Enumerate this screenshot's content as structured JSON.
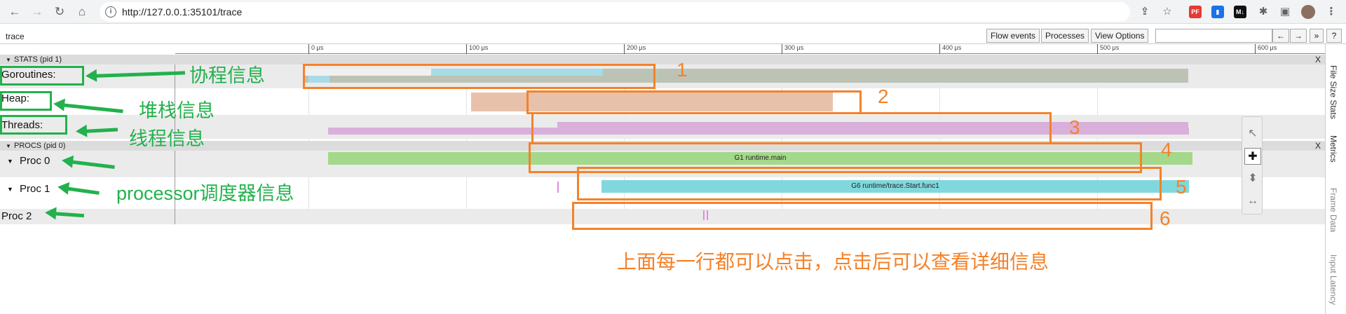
{
  "browser": {
    "url": "http://127.0.0.1:35101/trace",
    "nav": [
      "back-icon",
      "forward-icon",
      "reload-icon",
      "home-icon"
    ],
    "extensions": [
      {
        "name": "share-icon",
        "glyph": "⇪",
        "bg": "transparent"
      },
      {
        "name": "star-icon",
        "glyph": "☆",
        "bg": "transparent"
      },
      {
        "name": "pdf-extension-icon",
        "glyph": "PF",
        "bg": "#e53935"
      },
      {
        "name": "chart-extension-icon",
        "glyph": "▮",
        "bg": "#1a73e8"
      },
      {
        "name": "md-extension-icon",
        "glyph": "M↓",
        "bg": "#111111"
      },
      {
        "name": "puzzle-icon",
        "glyph": "✱",
        "bg": "transparent"
      },
      {
        "name": "sidepanel-icon",
        "glyph": "▣",
        "bg": "transparent"
      },
      {
        "name": "avatar",
        "glyph": "",
        "bg": "#8d6e63"
      },
      {
        "name": "menu-icon",
        "glyph": "⋮",
        "bg": "transparent"
      }
    ]
  },
  "toolbar": {
    "title": "trace",
    "flow_events": "Flow events",
    "processes": "Processes",
    "view_options": "View Options",
    "search_value": "",
    "prev": "←",
    "next": "→",
    "more": "»",
    "help": "?"
  },
  "ruler": {
    "ticks": [
      "0 μs",
      "100 μs",
      "200 μs",
      "300 μs",
      "400 μs",
      "500 μs",
      "600 μs"
    ]
  },
  "stats_group": {
    "label": "STATS (pid 1)",
    "close": "X",
    "rows": [
      "Goroutines:",
      "Heap:",
      "Threads:"
    ]
  },
  "procs_group": {
    "label": "PROCS (pid 0)",
    "close": "X",
    "rows": [
      "Proc 0",
      "Proc 1",
      "Proc 2"
    ]
  },
  "slices": {
    "proc0": "G1 runtime.main",
    "proc1": "G6 runtime/trace.Start.func1"
  },
  "annotations": {
    "box_numbers": [
      "1",
      "2",
      "3",
      "4",
      "5",
      "6"
    ],
    "goroutines": "协程信息",
    "heap": "堆栈信息",
    "threads": "线程信息",
    "processor": "processor调度器信息",
    "note": "上面每一行都可以点击，点击后可以查看详细信息"
  },
  "side_tabs": [
    "File Size Stats",
    "Metrics",
    "Frame Data",
    "Input Latency"
  ],
  "colors": {
    "annotation_orange": "#f4822a",
    "annotation_green": "#22b14c",
    "goroutine_blue": "#a8dbe8",
    "goroutine_gray": "#bcc3b5",
    "heap_salmon": "#e8c1aa",
    "threads_purple": "#d8b0da",
    "proc0_green": "#a4d88a",
    "proc1_cyan": "#80d8dc"
  }
}
